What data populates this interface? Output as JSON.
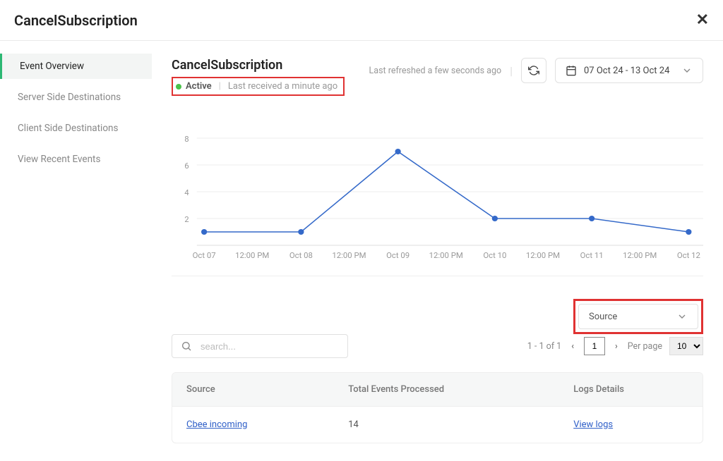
{
  "header": {
    "title": "CancelSubscription"
  },
  "sidebar": {
    "items": [
      {
        "label": "Event Overview",
        "active": true
      },
      {
        "label": "Server Side Destinations",
        "active": false
      },
      {
        "label": "Client Side Destinations",
        "active": false
      },
      {
        "label": "View Recent Events",
        "active": false
      }
    ]
  },
  "event": {
    "title": "CancelSubscription",
    "status_label": "Active",
    "status_sub": "Last received a minute ago"
  },
  "controls": {
    "last_refreshed": "Last refreshed a few seconds ago",
    "date_range": "07 Oct 24 - 13 Oct 24"
  },
  "chart_data": {
    "type": "line",
    "y_ticks": [
      2,
      4,
      6,
      8
    ],
    "x_ticks": [
      "Oct 07",
      "12:00 PM",
      "Oct 08",
      "12:00 PM",
      "Oct 09",
      "12:00 PM",
      "Oct 10",
      "12:00 PM",
      "Oct 11",
      "12:00 PM",
      "Oct 12"
    ],
    "x": [
      "Oct 07",
      "Oct 08",
      "Oct 09",
      "Oct 10",
      "Oct 11",
      "Oct 12"
    ],
    "values": [
      1,
      1,
      7,
      2,
      2,
      1
    ],
    "ylim": [
      0,
      8
    ]
  },
  "source_filter": {
    "label": "Source"
  },
  "search": {
    "placeholder": "search..."
  },
  "pagination": {
    "summary": "1 - 1 of 1",
    "page": "1",
    "per_page_label": "Per page",
    "per_page_value": "10"
  },
  "table": {
    "columns": [
      "Source",
      "Total Events Processed",
      "Logs Details"
    ],
    "rows": [
      {
        "source": "Cbee incoming",
        "total": "14",
        "logs": "View logs"
      }
    ]
  }
}
